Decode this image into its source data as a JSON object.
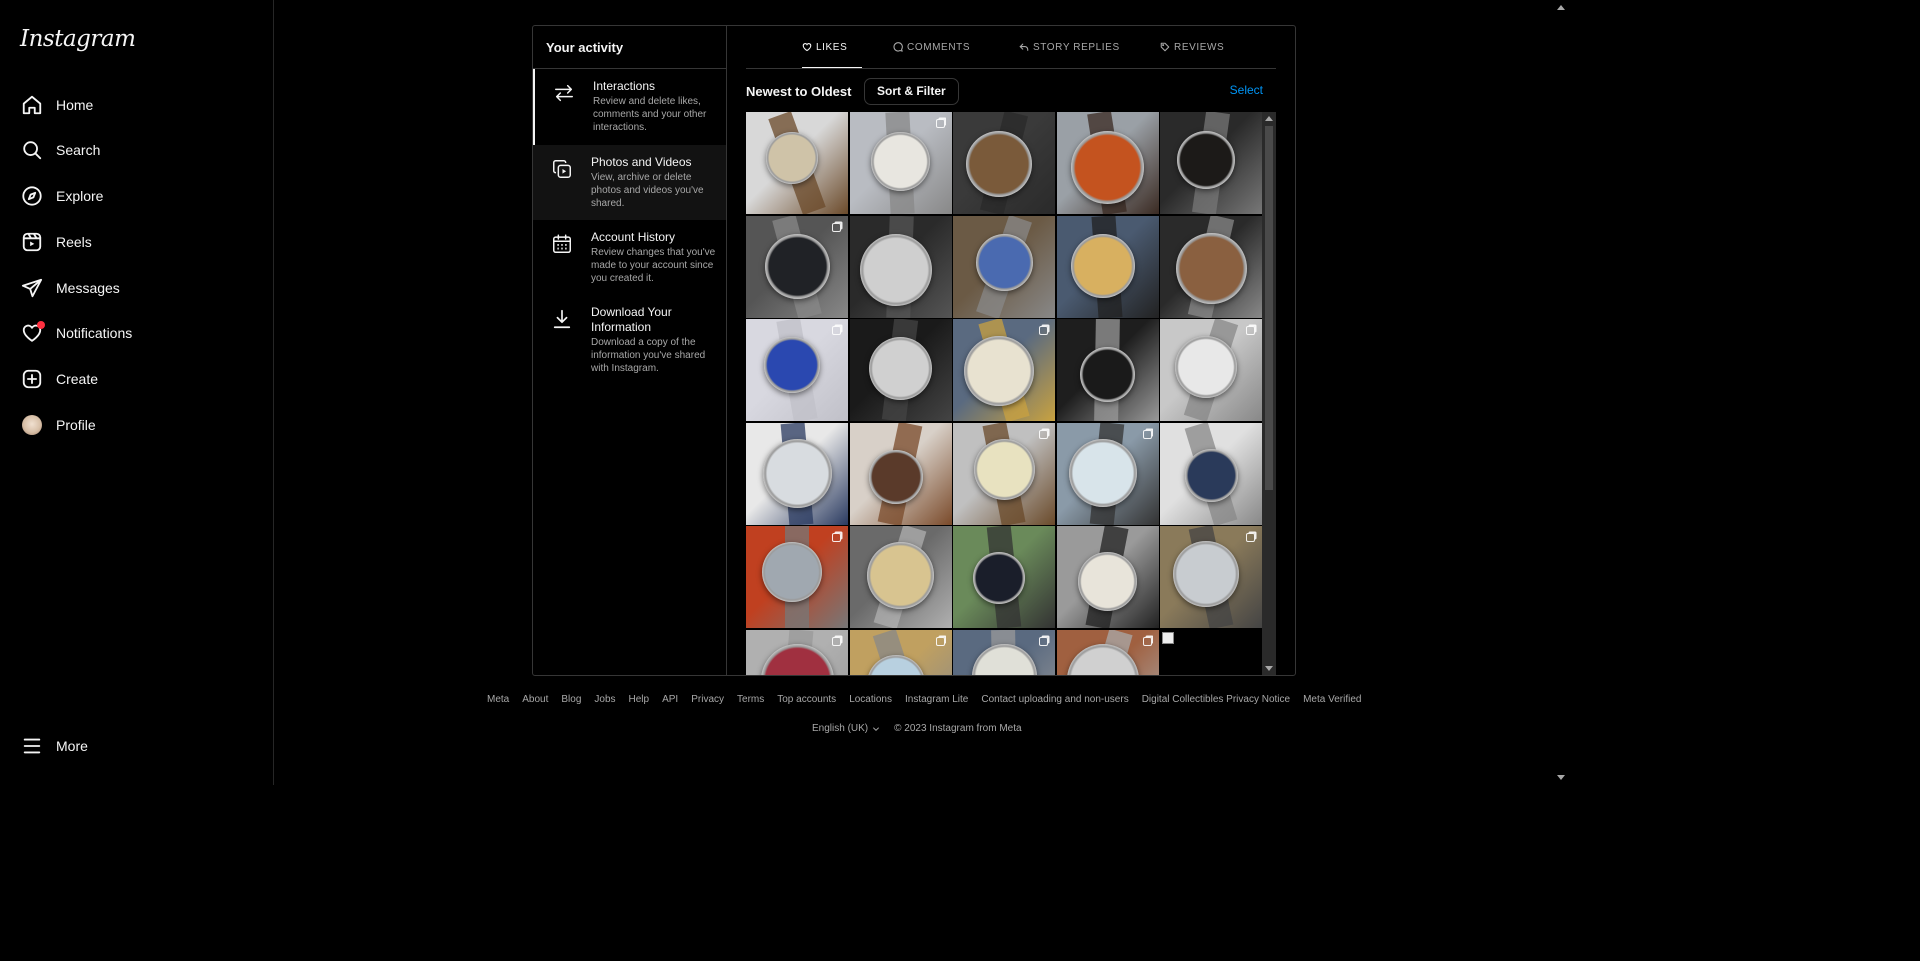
{
  "brand": {
    "logo_text": "Instagram"
  },
  "nav": {
    "items": [
      {
        "label": "Home",
        "icon": "home-icon"
      },
      {
        "label": "Search",
        "icon": "search-icon"
      },
      {
        "label": "Explore",
        "icon": "compass-icon"
      },
      {
        "label": "Reels",
        "icon": "reels-icon"
      },
      {
        "label": "Messages",
        "icon": "send-icon"
      },
      {
        "label": "Notifications",
        "icon": "heart-icon"
      },
      {
        "label": "Create",
        "icon": "plus-square-icon"
      },
      {
        "label": "Profile",
        "icon": "avatar"
      }
    ],
    "more": {
      "label": "More",
      "icon": "menu-icon"
    }
  },
  "activity": {
    "title": "Your activity",
    "items": [
      {
        "title": "Interactions",
        "desc": "Review and delete likes, comments and your other interactions.",
        "icon": "arrows-icon"
      },
      {
        "title": "Photos and Videos",
        "desc": "View, archive or delete photos and videos you've shared.",
        "icon": "media-icon"
      },
      {
        "title": "Account History",
        "desc": "Review changes that you've made to your account since you created it.",
        "icon": "calendar-icon"
      },
      {
        "title": "Download Your Information",
        "desc": "Download a copy of the information you've shared with Instagram.",
        "icon": "download-icon"
      }
    ]
  },
  "tabs": [
    {
      "label": "LIKES",
      "icon": "heart-icon"
    },
    {
      "label": "COMMENTS",
      "icon": "comment-icon"
    },
    {
      "label": "STORY REPLIES",
      "icon": "reply-icon"
    },
    {
      "label": "REVIEWS",
      "icon": "tag-icon"
    }
  ],
  "sort": {
    "title": "Newest to Oldest",
    "button": "Sort & Filter",
    "select": "Select"
  },
  "footer": {
    "links": [
      "Meta",
      "About",
      "Blog",
      "Jobs",
      "Help",
      "API",
      "Privacy",
      "Terms",
      "Top accounts",
      "Locations",
      "Instagram Lite",
      "Contact uploading and non-users",
      "Digital Collectibles Privacy Notice",
      "Meta Verified"
    ],
    "language": "English (UK)",
    "copyright": "© 2023 Instagram from Meta"
  },
  "colors": {
    "accent": "#0095f6",
    "notification": "#ff3040"
  }
}
